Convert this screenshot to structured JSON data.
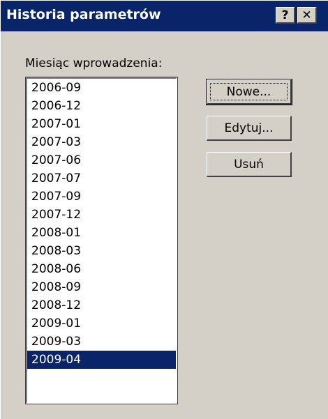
{
  "window": {
    "title": "Historia parametrów",
    "help_label": "?",
    "close_label": "✕"
  },
  "list": {
    "label": "Miesiąc wprowadzenia:",
    "items": [
      "2006-09",
      "2006-12",
      "2007-01",
      "2007-03",
      "2007-06",
      "2007-07",
      "2007-09",
      "2007-12",
      "2008-01",
      "2008-03",
      "2008-06",
      "2008-09",
      "2008-12",
      "2009-01",
      "2009-03",
      "2009-04"
    ],
    "selected": "2009-04"
  },
  "buttons": {
    "new_label": "Nowe...",
    "edit_label": "Edytuj...",
    "delete_label": "Usuń"
  },
  "colors": {
    "titlebar": "#0a246a",
    "face": "#d4d0c8",
    "selection": "#0a246a"
  }
}
